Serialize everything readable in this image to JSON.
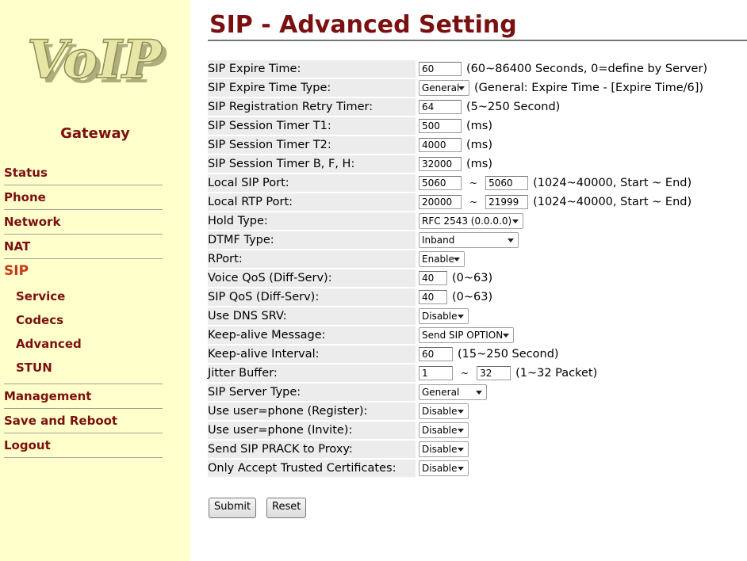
{
  "sidebar": {
    "logo_text": "VoIP",
    "subtitle": "Gateway",
    "nav": {
      "status": "Status",
      "phone": "Phone",
      "network": "Network",
      "nat": "NAT",
      "sip": "SIP",
      "service": "Service",
      "codecs": "Codecs",
      "advanced": "Advanced",
      "stun": "STUN",
      "management": "Management",
      "save_reboot": "Save and Reboot",
      "logout": "Logout"
    }
  },
  "page": {
    "title": "SIP - Advanced Setting"
  },
  "rows": {
    "expire_time": {
      "label": "SIP Expire Time:",
      "value": "60",
      "hint": "(60~86400 Seconds, 0=define by Server)"
    },
    "expire_type": {
      "label": "SIP Expire Time Type:",
      "value": "General",
      "hint": "(General: Expire Time - [Expire Time/6])"
    },
    "retry_timer": {
      "label": "SIP Registration Retry Timer:",
      "value": "64",
      "hint": "(5~250 Second)"
    },
    "t1": {
      "label": "SIP Session Timer T1:",
      "value": "500",
      "hint": "(ms)"
    },
    "t2": {
      "label": "SIP Session Timer T2:",
      "value": "4000",
      "hint": "(ms)"
    },
    "bfh": {
      "label": "SIP Session Timer B, F, H:",
      "value": "32000",
      "hint": "(ms)"
    },
    "sip_port": {
      "label": "Local SIP Port:",
      "start": "5060",
      "sep": "~",
      "end": "5060",
      "hint": "(1024~40000, Start ~ End)"
    },
    "rtp_port": {
      "label": "Local RTP Port:",
      "start": "20000",
      "sep": "~",
      "end": "21999",
      "hint": "(1024~40000, Start ~ End)"
    },
    "hold_type": {
      "label": "Hold Type:",
      "value": "RFC 2543 (0.0.0.0)"
    },
    "dtmf_type": {
      "label": "DTMF Type:",
      "value": "Inband"
    },
    "rport": {
      "label": "RPort:",
      "value": "Enable"
    },
    "voice_qos": {
      "label": "Voice QoS (Diff-Serv):",
      "value": "40",
      "hint": "(0~63)"
    },
    "sip_qos": {
      "label": "SIP QoS (Diff-Serv):",
      "value": "40",
      "hint": "(0~63)"
    },
    "dns_srv": {
      "label": "Use DNS SRV:",
      "value": "Disable"
    },
    "keepalive_msg": {
      "label": "Keep-alive Message:",
      "value": "Send SIP OPTION"
    },
    "keepalive_int": {
      "label": "Keep-alive Interval:",
      "value": "60",
      "hint": "(15~250 Second)"
    },
    "jitter": {
      "label": "Jitter Buffer:",
      "start": "1",
      "sep": "~",
      "end": "32",
      "hint": "(1~32 Packet)"
    },
    "server_type": {
      "label": "SIP Server Type:",
      "value": "General"
    },
    "userphone_reg": {
      "label": "Use user=phone (Register):",
      "value": "Disable"
    },
    "userphone_inv": {
      "label": "Use user=phone (Invite):",
      "value": "Disable"
    },
    "prack": {
      "label": "Send SIP PRACK to Proxy:",
      "value": "Disable"
    },
    "trusted_certs": {
      "label": "Only Accept Trusted Certificates:",
      "value": "Disable"
    }
  },
  "buttons": {
    "submit": "Submit",
    "reset": "Reset"
  }
}
